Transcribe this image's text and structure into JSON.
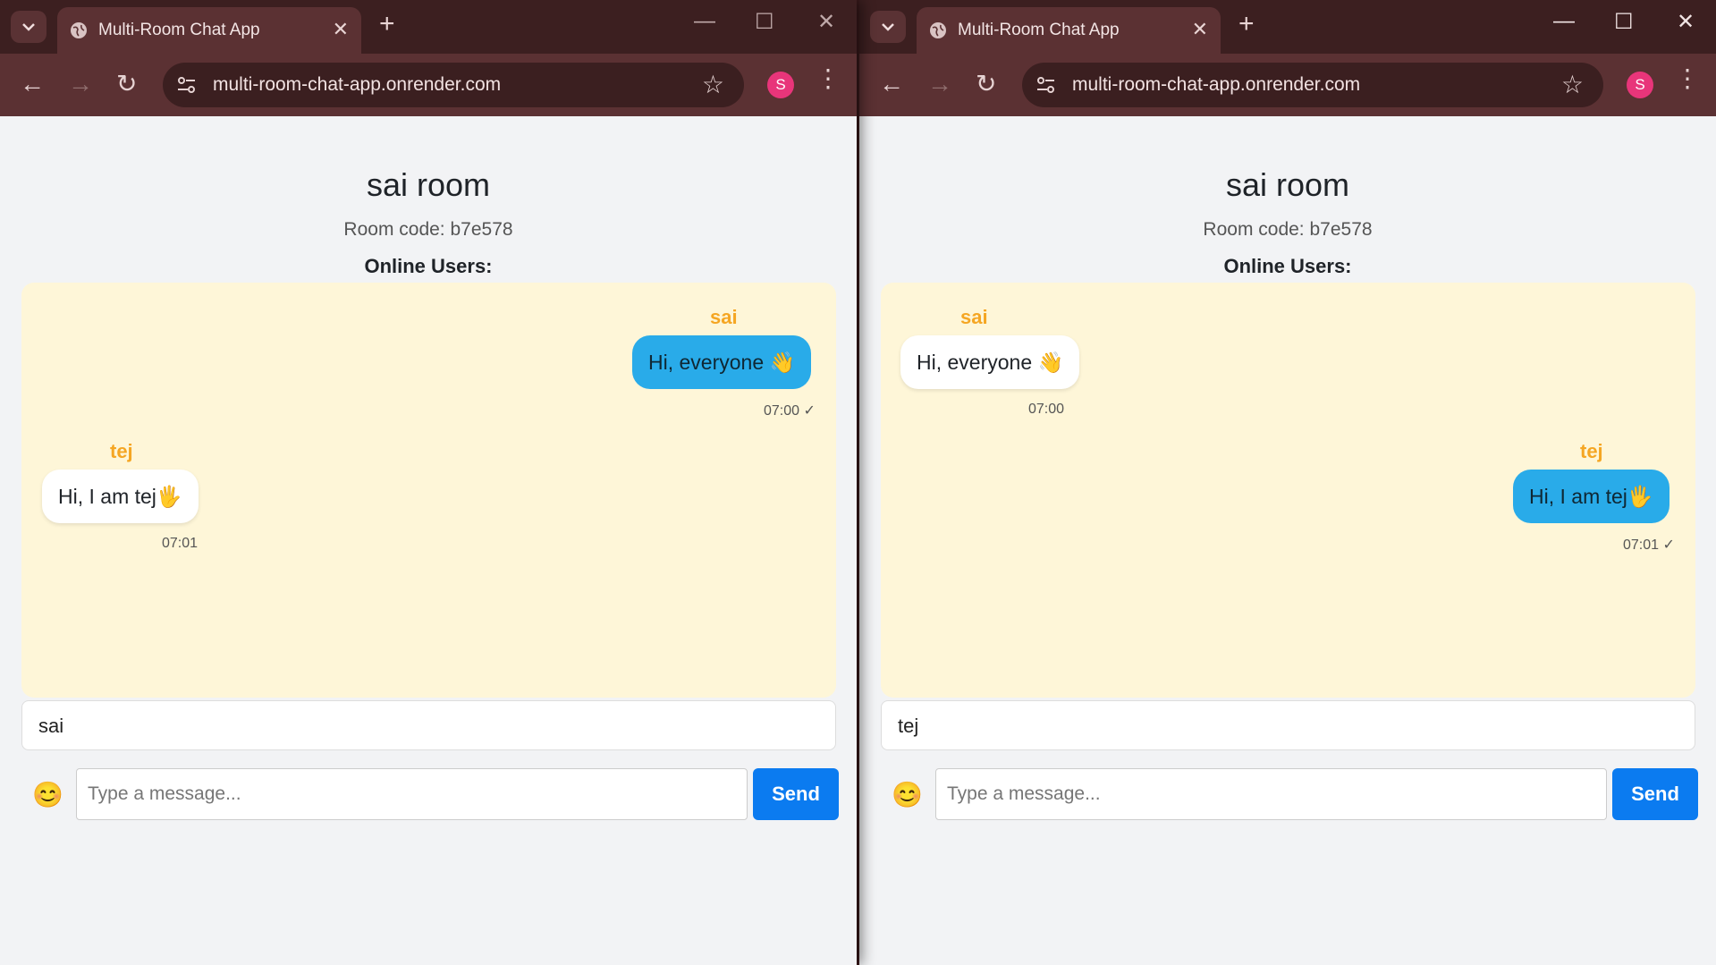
{
  "windows": [
    {
      "tab_title": "Multi-Room Chat App",
      "url": "multi-room-chat-app.onrender.com",
      "profile_initial": "S",
      "room_title": "sai room",
      "room_code": "Room code: b7e578",
      "online_users_label": "Online Users:",
      "messages": [
        {
          "sender": "sai",
          "text": "Hi, everyone 👋",
          "time": "07:00 ✓",
          "own": true
        },
        {
          "sender": "tej",
          "text": "Hi, I am tej🖐️",
          "time": "07:01",
          "own": false
        }
      ],
      "username": "sai",
      "emoji_button": "😊",
      "message_placeholder": "Type a message...",
      "send_label": "Send"
    },
    {
      "tab_title": "Multi-Room Chat App",
      "url": "multi-room-chat-app.onrender.com",
      "profile_initial": "S",
      "room_title": "sai room",
      "room_code": "Room code: b7e578",
      "online_users_label": "Online Users:",
      "messages": [
        {
          "sender": "sai",
          "text": "Hi, everyone 👋",
          "time": "07:00",
          "own": false
        },
        {
          "sender": "tej",
          "text": "Hi, I am tej🖐️",
          "time": "07:01 ✓",
          "own": true
        }
      ],
      "username": "tej",
      "emoji_button": "😊",
      "message_placeholder": "Type a message...",
      "send_label": "Send"
    }
  ],
  "colors": {
    "titlebar": "#3c1f20",
    "toolbar": "#5b3133",
    "chat_bg": "#fef6d8",
    "own_bubble": "#29abe9",
    "other_bubble": "#ffffff",
    "sender_name": "#f5a623",
    "send_button": "#0b7bf0",
    "profile_avatar": "#e8357a"
  }
}
